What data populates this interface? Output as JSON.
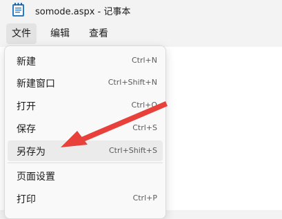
{
  "window": {
    "title": "somode.aspx - 记事本",
    "icon": "notepad-icon"
  },
  "menubar": {
    "items": [
      {
        "label": "文件",
        "active": true
      },
      {
        "label": "编辑",
        "active": false
      },
      {
        "label": "查看",
        "active": false
      }
    ]
  },
  "file_menu": {
    "items": [
      {
        "label": "新建",
        "shortcut": "Ctrl+N"
      },
      {
        "label": "新建窗口",
        "shortcut": "Ctrl+Shift+N"
      },
      {
        "label": "打开",
        "shortcut": "Ctrl+O"
      },
      {
        "label": "保存",
        "shortcut": "Ctrl+S"
      },
      {
        "label": "另存为",
        "shortcut": "Ctrl+Shift+S",
        "highlighted": true
      },
      {
        "label": "页面设置",
        "shortcut": ""
      },
      {
        "label": "打印",
        "shortcut": "Ctrl+P"
      }
    ]
  },
  "annotation": {
    "type": "arrow",
    "color": "#e8403a",
    "points_to": "另存为"
  }
}
